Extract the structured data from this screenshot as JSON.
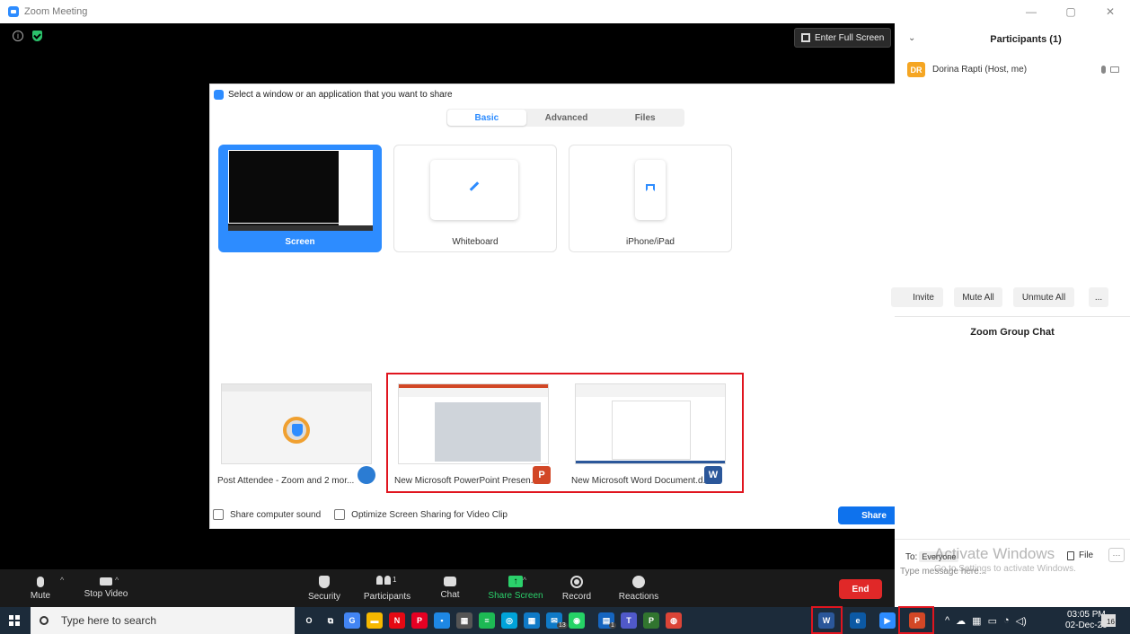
{
  "window": {
    "title": "Zoom Meeting"
  },
  "meeting": {
    "fullscreen_label": "Enter Full Screen"
  },
  "toolbar": {
    "mute": "Mute",
    "stop_video": "Stop Video",
    "security": "Security",
    "participants": "Participants",
    "participants_count": "1",
    "chat": "Chat",
    "share_screen": "Share Screen",
    "record": "Record",
    "reactions": "Reactions",
    "end": "End"
  },
  "panel": {
    "title": "Participants (1)",
    "participant": {
      "initials": "DR",
      "name": "Dorina Rapti (Host, me)"
    },
    "buttons": {
      "invite": "Invite",
      "mute_all": "Mute All",
      "unmute_all": "Unmute All",
      "more": "..."
    },
    "chat_title": "Zoom Group Chat",
    "chat_to": "To:",
    "chat_recipient": "Everyone",
    "chat_placeholder": "Type message here...",
    "file_label": "File",
    "more_label": "···",
    "watermark_line1": "Activate Windows",
    "watermark_line2": "Go to Settings to activate Windows."
  },
  "dialog": {
    "title": "Select a window or an application that you want to share",
    "tabs": [
      "Basic",
      "Advanced",
      "Files"
    ],
    "active_tab": "Basic",
    "cards": {
      "screen": "Screen",
      "whiteboard": "Whiteboard",
      "iphone": "iPhone/iPad"
    },
    "apps": [
      {
        "label": "Post Attendee - Zoom and 2 mor...",
        "badge": "",
        "color": "#2b7cd3"
      },
      {
        "label": "New Microsoft PowerPoint Presen...",
        "badge": "P",
        "color": "#d24726"
      },
      {
        "label": "New Microsoft Word Document.d...",
        "badge": "W",
        "color": "#2b579a"
      }
    ],
    "option_sound": "Share computer sound",
    "option_optimize": "Optimize Screen Sharing for Video Clip",
    "share_button": "Share"
  },
  "taskbar": {
    "search_placeholder": "Type here to search",
    "apps": [
      {
        "name": "cortana",
        "glyph": "O",
        "color": "transparent"
      },
      {
        "name": "task-view",
        "glyph": "⧉",
        "color": "transparent"
      },
      {
        "name": "google",
        "glyph": "G",
        "color": "#4285f4"
      },
      {
        "name": "file-explorer",
        "glyph": "▬",
        "color": "#f5b800"
      },
      {
        "name": "netflix",
        "glyph": "N",
        "color": "#e50914"
      },
      {
        "name": "pinterest",
        "glyph": "P",
        "color": "#e60023"
      },
      {
        "name": "app-blue",
        "glyph": "▪",
        "color": "#1e88e5"
      },
      {
        "name": "calculator",
        "glyph": "▦",
        "color": "#555"
      },
      {
        "name": "spotify",
        "glyph": "≡",
        "color": "#1db954"
      },
      {
        "name": "app-teal",
        "glyph": "◎",
        "color": "#00a3d9"
      },
      {
        "name": "calendar",
        "glyph": "▦",
        "color": "#0f7ac7"
      },
      {
        "name": "mail",
        "glyph": "✉",
        "color": "#0f7ac7",
        "count": "13"
      },
      {
        "name": "whatsapp",
        "glyph": "◉",
        "color": "#25d366"
      },
      {
        "name": "app-files",
        "glyph": "▤",
        "color": "#1565c0",
        "count": "1"
      },
      {
        "name": "teams",
        "glyph": "T",
        "color": "#5059c9"
      },
      {
        "name": "project",
        "glyph": "P",
        "color": "#31752f"
      },
      {
        "name": "chrome",
        "glyph": "◍",
        "color": "#db4437"
      },
      {
        "name": "word",
        "glyph": "W",
        "color": "#2b579a"
      },
      {
        "name": "edge",
        "glyph": "e",
        "color": "#0c59a4"
      },
      {
        "name": "zoom",
        "glyph": "▶",
        "color": "#2d8cff"
      },
      {
        "name": "powerpoint",
        "glyph": "P",
        "color": "#d24726"
      }
    ],
    "time": "03:05 PM",
    "date": "02-Dec-20",
    "notifications": "16"
  }
}
